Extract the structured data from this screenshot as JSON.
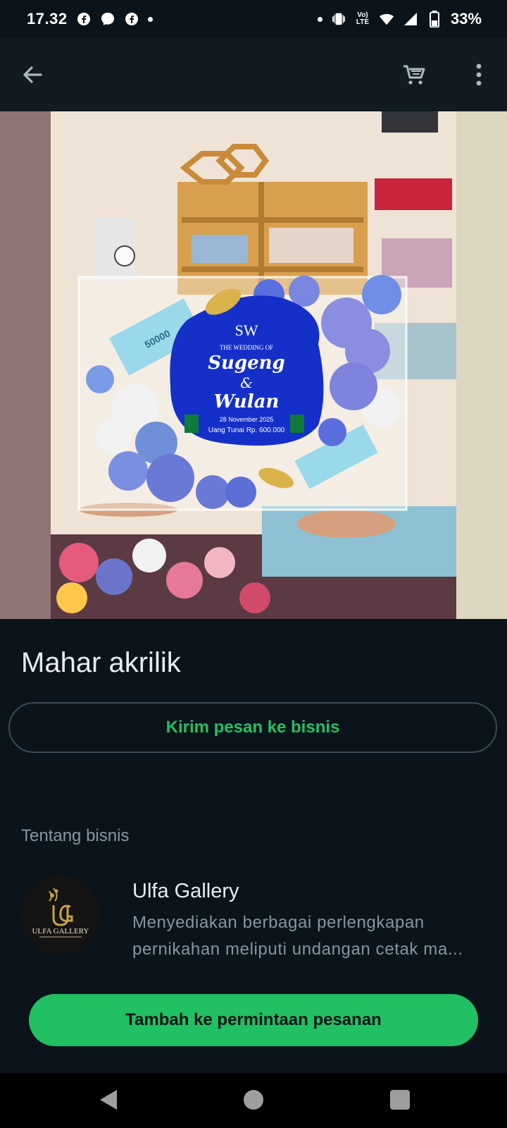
{
  "status_bar": {
    "time": "17.32",
    "battery": "33%",
    "volte_top": "Vo)",
    "volte_bottom": "LTE",
    "left_icons": [
      "facebook-icon",
      "messenger-icon",
      "facebook-icon",
      "dot-icon"
    ],
    "right_icons": [
      "dot-icon",
      "vibrate-icon",
      "volte-icon",
      "wifi-icon",
      "signal-icon",
      "battery-icon"
    ]
  },
  "app_bar": {
    "icons": [
      "back-arrow-icon",
      "cart-icon",
      "more-vert-icon"
    ]
  },
  "product": {
    "title": "Mahar akrilik",
    "image": {
      "monogram": "SW",
      "subtitle": "THE WEDDING OF",
      "name1": "Sugeng",
      "amp": "&",
      "name2": "Wulan",
      "date": "28 November 2025",
      "amount": "Uang Tunai Rp. 600.000",
      "banknote": "50000"
    }
  },
  "actions": {
    "message_button": "Kirim pesan ke bisnis",
    "add_button": "Tambah ke permintaan pesanan"
  },
  "about": {
    "label": "Tentang bisnis",
    "business_name": "Ulfa Gallery",
    "description_line1": "Menyediakan berbagai perlengkapan",
    "description_line2": "pernikahan meliputi undangan cetak ma...",
    "logo_text": "ULFA GALLERY"
  },
  "colors": {
    "background": "#0b141a",
    "app_bar": "#111b21",
    "accent_green": "#21c063",
    "secondary_text": "#8696a0"
  }
}
